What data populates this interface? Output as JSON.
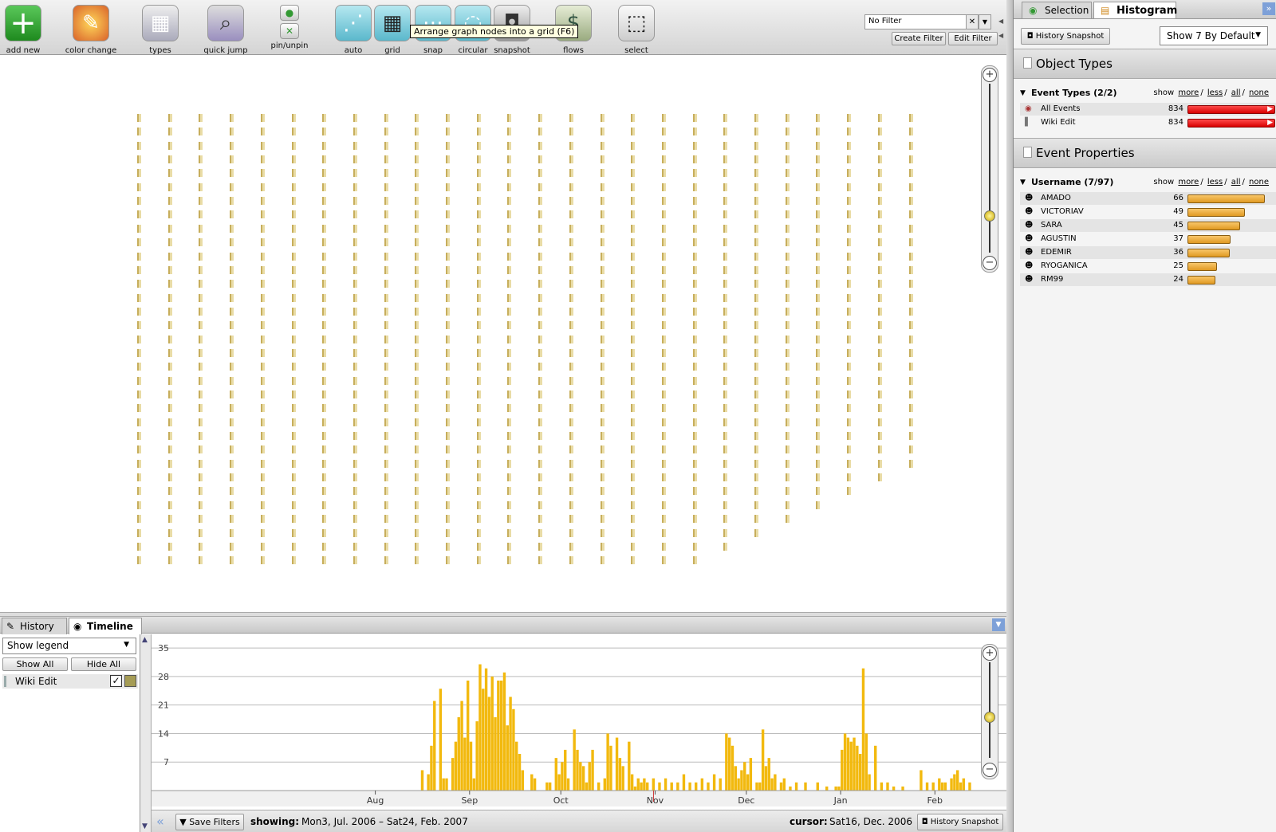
{
  "toolbar": {
    "buttons": [
      {
        "label": "add new",
        "icon": "plus-icon"
      },
      {
        "label": "color change",
        "icon": "paint-icon"
      },
      {
        "label": "types",
        "icon": "types-icon"
      },
      {
        "label": "quick jump",
        "icon": "quick-jump-icon"
      },
      {
        "label": "pin/unpin",
        "icon": "pin-icon"
      },
      {
        "label": "auto",
        "icon": "auto-layout-icon"
      },
      {
        "label": "grid",
        "icon": "grid-layout-icon"
      },
      {
        "label": "snap",
        "icon": "snap-icon"
      },
      {
        "label": "circular",
        "icon": "circular-layout-icon"
      },
      {
        "label": "snapshot",
        "icon": "camera-icon"
      },
      {
        "label": "flows",
        "icon": "flows-icon"
      },
      {
        "label": "select",
        "icon": "select-icon"
      }
    ],
    "tooltip": "Arrange graph nodes into a grid (F6)",
    "filter_value": "No Filter",
    "create_filter": "Create Filter",
    "edit_filter": "Edit Filter"
  },
  "graph": {
    "columns": [
      33,
      33,
      33,
      33,
      33,
      33,
      33,
      33,
      33,
      33,
      33,
      33,
      33,
      33,
      33,
      33,
      33,
      33,
      33,
      32,
      31,
      30,
      29,
      28,
      27,
      26
    ]
  },
  "bottom_tabs": [
    {
      "label": "History",
      "active": false
    },
    {
      "label": "Timeline",
      "active": true
    }
  ],
  "legend": {
    "select_value": "Show legend",
    "show_all": "Show All",
    "hide_all": "Hide All",
    "items": [
      {
        "label": "Wiki Edit",
        "checked": true,
        "color": "#a59c55"
      }
    ]
  },
  "status": {
    "save_filters": "Save Filters",
    "showing_label": "showing:",
    "showing_value": "Mon3, Jul. 2006 – Sat24, Feb. 2007",
    "cursor_label": "cursor:",
    "cursor_value": "Sat16, Dec. 2006",
    "history_snapshot": "History Snapshot"
  },
  "chart_data": {
    "type": "bar",
    "title": "",
    "xlabel": "",
    "ylabel": "",
    "x_ticks": [
      "Aug",
      "Sep",
      "Oct",
      "Nov",
      "Dec",
      "Jan",
      "Feb"
    ],
    "y_ticks": [
      7,
      14,
      21,
      28,
      35
    ],
    "ylim": [
      0,
      36
    ],
    "xlim_days": [
      0,
      236
    ],
    "bar_color": "#f2b90e",
    "series": [
      {
        "name": "Wiki Edit",
        "day_offsets": [
          44,
          46,
          47,
          48,
          50,
          51,
          52,
          54,
          55,
          56,
          57,
          58,
          59,
          60,
          61,
          62,
          63,
          64,
          65,
          66,
          67,
          68,
          69,
          70,
          71,
          72,
          73,
          74,
          75,
          76,
          77,
          80,
          81,
          85,
          86,
          88,
          89,
          90,
          91,
          92,
          94,
          95,
          96,
          97,
          98,
          99,
          100,
          102,
          104,
          105,
          106,
          108,
          109,
          110,
          112,
          113,
          114,
          115,
          116,
          117,
          118,
          120,
          122,
          124,
          126,
          128,
          130,
          132,
          134,
          136,
          138,
          140,
          142,
          144,
          145,
          146,
          147,
          148,
          149,
          150,
          151,
          152,
          154,
          155,
          156,
          157,
          158,
          159,
          160,
          162,
          163,
          165,
          167,
          170,
          174,
          177,
          180,
          181,
          182,
          183,
          184,
          185,
          186,
          187,
          188,
          189,
          190,
          191,
          193,
          195,
          197,
          199,
          202,
          208,
          210,
          212,
          214,
          215,
          216,
          218,
          219,
          220,
          221,
          222,
          224
        ],
        "values": [
          5,
          4,
          11,
          22,
          25,
          3,
          3,
          8,
          12,
          18,
          22,
          13,
          27,
          12,
          3,
          17,
          31,
          25,
          30,
          23,
          28,
          18,
          27,
          27,
          29,
          16,
          23,
          20,
          12,
          9,
          5,
          4,
          3,
          2,
          2,
          8,
          4,
          7,
          10,
          3,
          15,
          10,
          7,
          6,
          2,
          7,
          10,
          2,
          3,
          14,
          11,
          13,
          8,
          6,
          12,
          4,
          1,
          3,
          2,
          3,
          2,
          3,
          2,
          3,
          2,
          2,
          4,
          2,
          2,
          3,
          2,
          4,
          3,
          14,
          13,
          11,
          6,
          3,
          5,
          7,
          4,
          8,
          2,
          2,
          15,
          6,
          8,
          3,
          4,
          2,
          3,
          1,
          2,
          2,
          2,
          1,
          1,
          1,
          10,
          14,
          13,
          12,
          13,
          11,
          9,
          30,
          14,
          4,
          11,
          2,
          2,
          1,
          1,
          5,
          2,
          2,
          3,
          2,
          2,
          3,
          4,
          5,
          2,
          3,
          2
        ]
      }
    ]
  },
  "right_panel": {
    "tabs": [
      {
        "label": "Selection",
        "active": false
      },
      {
        "label": "Histogram",
        "active": true
      }
    ],
    "history_snapshot": "History Snapshot",
    "show_default": "Show 7 By Default",
    "object_types_title": "Object Types",
    "event_types": {
      "header": "Event Types (2/2)",
      "show_label": "show",
      "rows": [
        {
          "label": "All Events",
          "count": 834,
          "fraction": 1.0
        },
        {
          "label": "Wiki Edit",
          "count": 834,
          "fraction": 1.0
        }
      ]
    },
    "event_properties_title": "Event Properties",
    "username": {
      "header": "Username (7/97)",
      "show_label": "show",
      "rows": [
        {
          "label": "AMADO",
          "count": 66
        },
        {
          "label": "VICTORIAV",
          "count": 49
        },
        {
          "label": "SARA",
          "count": 45
        },
        {
          "label": "AGUSTIN",
          "count": 37
        },
        {
          "label": "EDEMIR",
          "count": 36
        },
        {
          "label": "RYOGANICA",
          "count": 25
        },
        {
          "label": "RM99",
          "count": 24
        }
      ]
    },
    "links": {
      "more": "more",
      "less": "less",
      "all": "all",
      "none": "none"
    }
  }
}
